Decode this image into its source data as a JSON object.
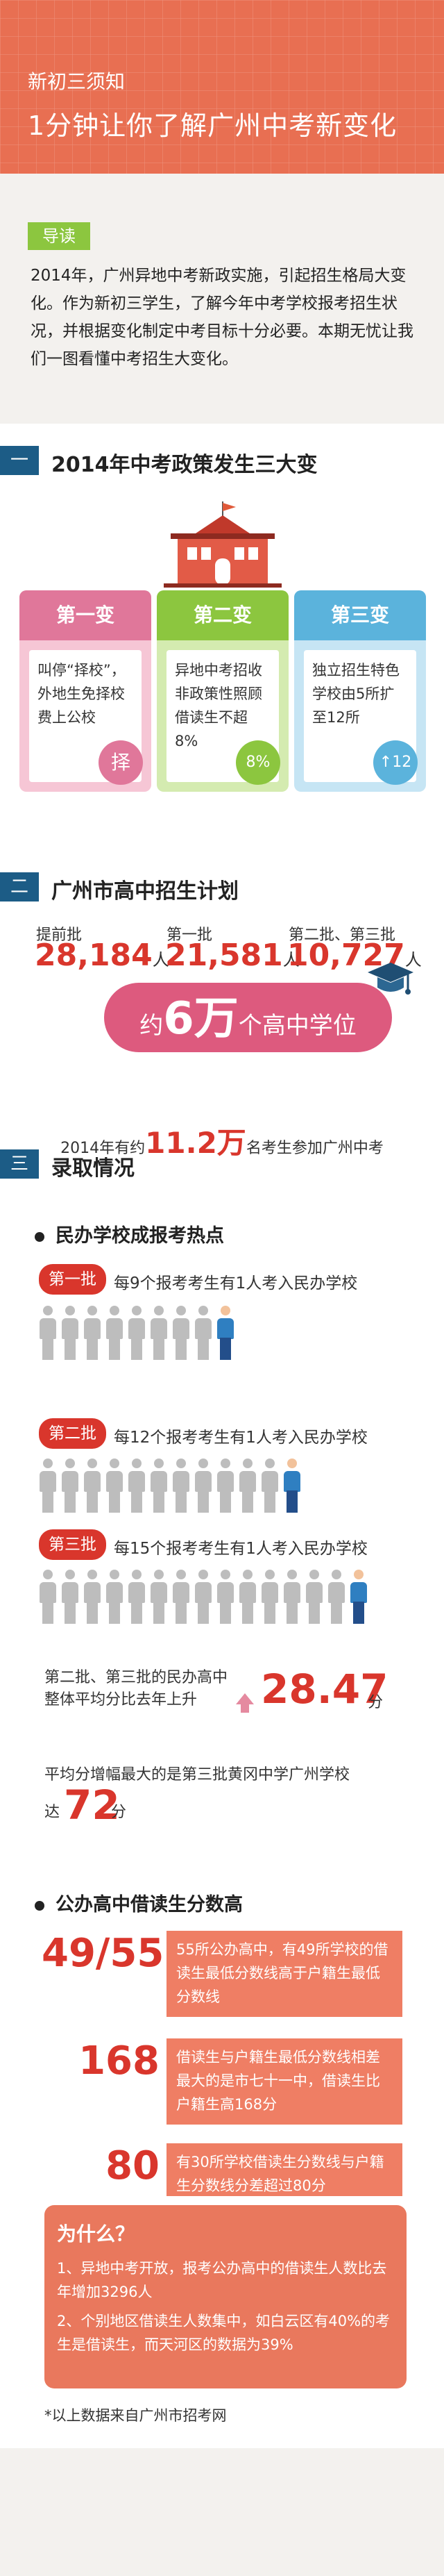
{
  "header": {
    "kicker": "新初三须知",
    "title": "1分钟让你了解广州中考新变化"
  },
  "intro": {
    "tag": "导读",
    "text": "2014年，广州异地中考新政实施，引起招生格局大变化。作为新初三学生，了解今年中考学校报考招生状况，并根据变化制定中考目标十分必要。本期无忧让我们一图看懂中考招生大变化。"
  },
  "section1": {
    "num": "一",
    "title": "2014年中考政策发生三大变",
    "cards": [
      {
        "title": "第一变",
        "text": "叫停“择校”，外地生免择校费上公校",
        "badge": "择",
        "color": "#e0779a"
      },
      {
        "title": "第二变",
        "text": "异地中考招收非政策性照顾借读生不超8%",
        "badge": "8%",
        "color": "#8cc63f"
      },
      {
        "title": "第三变",
        "text": "独立招生特色学校由5所扩至12所",
        "badge": "↑12",
        "color": "#5bb3dc"
      }
    ]
  },
  "section2": {
    "num": "二",
    "title": "广州市高中招生计划",
    "items": [
      {
        "label": "提前批",
        "value": "28,184",
        "unit": "人"
      },
      {
        "label": "第一批",
        "value": "21,581",
        "unit": "人"
      },
      {
        "label": "第二批、第三批",
        "value": "10,727",
        "unit": "人"
      }
    ],
    "pill": {
      "pre": "约",
      "num": "6万",
      "post": "个高中学位"
    },
    "total": {
      "pre": "2014年有约",
      "num": "11.2万",
      "post": "名考生参加广州中考"
    }
  },
  "section3": {
    "num": "三",
    "title": "录取情况",
    "private": {
      "title": "民办学校成报考热点",
      "batches": [
        {
          "label": "第一批",
          "text": "每9个报考考生有1人考入民办学校",
          "count": 9
        },
        {
          "label": "第二批",
          "text": "每12个报考考生有1人考入民办学校",
          "count": 12
        },
        {
          "label": "第三批",
          "text": "每15个报考考生有1人考入民办学校",
          "count": 15
        }
      ],
      "rise_text_1": "第二批、第三批的民办高中",
      "rise_text_2": "整体平均分比去年上升",
      "rise_value": "28.47",
      "rise_unit": "分",
      "max_text": "平均分增幅最大的是第三批黄冈中学广州学校",
      "max_pre": "达",
      "max_value": "72",
      "max_unit": "分"
    },
    "public": {
      "title": "公办高中借读生分数高",
      "rows": [
        {
          "num": "49/55",
          "text": "55所公办高中，有49所学校的借读生最低分数线高于户籍生最低分数线"
        },
        {
          "num": "168",
          "text": "借读生与户籍生最低分数线相差最大的是市七十一中，借读生比户籍生高168分"
        },
        {
          "num": "80",
          "text": "有30所学校借读生分数线与户籍生分数线分差超过80分"
        }
      ],
      "why_title": "为什么？",
      "why_items": [
        "1、异地中考开放，报考公办高中的借读生人数比去年增加3296人",
        "2、个别地区借读生人数集中，如白云区有40%的考生是借读生，而天河区的数据为39%"
      ]
    }
  },
  "source": "*以上数据来自广州市招考网",
  "colors": {
    "accent": "#e86f52",
    "navy": "#1c5c86",
    "red": "#d9362c",
    "green": "#8cc63f",
    "pink": "#dd5a7e"
  }
}
